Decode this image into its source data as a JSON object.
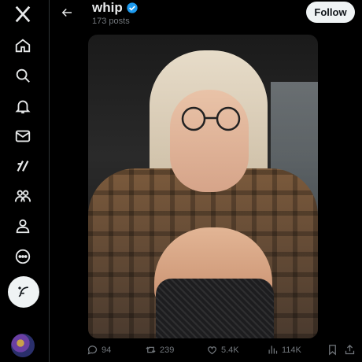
{
  "sidebar": {
    "items": [
      {
        "icon": "x-logo-icon"
      },
      {
        "icon": "home-icon"
      },
      {
        "icon": "search-icon"
      },
      {
        "icon": "bell-icon"
      },
      {
        "icon": "mail-icon"
      },
      {
        "icon": "grok-icon"
      },
      {
        "icon": "communities-icon"
      },
      {
        "icon": "profile-icon"
      },
      {
        "icon": "more-icon"
      }
    ],
    "compose_icon": "compose-feather-icon"
  },
  "header": {
    "title": "whip",
    "posts_count": "173 posts",
    "follow_label": "Follow"
  },
  "actions": {
    "replies": "94",
    "reposts": "239",
    "likes": "5.4K",
    "views": "114K"
  },
  "colors": {
    "background": "#000000",
    "verified": "#1d9bf0",
    "follow_bg": "#eff3f4",
    "muted_text": "#71767b"
  }
}
